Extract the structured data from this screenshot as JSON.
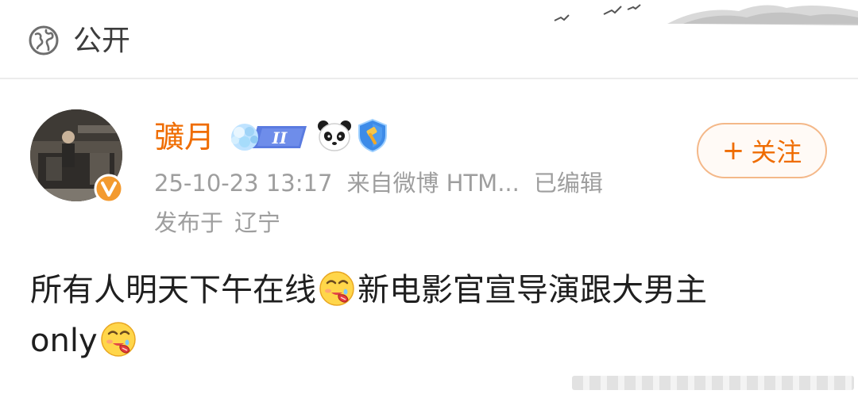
{
  "topbar": {
    "icon": "globe-icon",
    "visibility": "公开"
  },
  "post": {
    "author": {
      "name": "彍月",
      "level": "II",
      "name_color": "#ef6c00",
      "badges": [
        "level-badge",
        "panda-icon",
        "shield-icon"
      ],
      "verified": true
    },
    "timestamp": "25-10-23 13:17",
    "source": "来自微博 HTM...",
    "edited": "已编辑",
    "location_prefix": "发布于",
    "location": "辽宁",
    "follow_button": {
      "plus": "+",
      "label": "关注"
    },
    "text": {
      "part1": "所有人明天下午在线",
      "part2": "新电影官宣导演跟大男主",
      "part3": "only"
    },
    "emoji": "drooling-face-emoji"
  },
  "colors": {
    "accent": "#ef6c00",
    "meta_text": "#9e9e9e",
    "body_text": "#1f1f1f"
  }
}
